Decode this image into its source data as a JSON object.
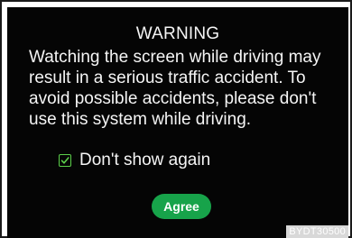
{
  "dialog": {
    "title": "WARNING",
    "message": "Watching the screen while driving may\nresult in a serious traffic accident. To\navoid possible accidents, please don't\nuse this system while driving.",
    "checkbox_label": "Don't show again",
    "checkbox_checked": true,
    "agree_label": "Agree"
  },
  "image_code": "BYDT30500",
  "colors": {
    "background": "#050505",
    "accent_green": "#17a34a",
    "checkbox_green": "#5cd04a"
  }
}
